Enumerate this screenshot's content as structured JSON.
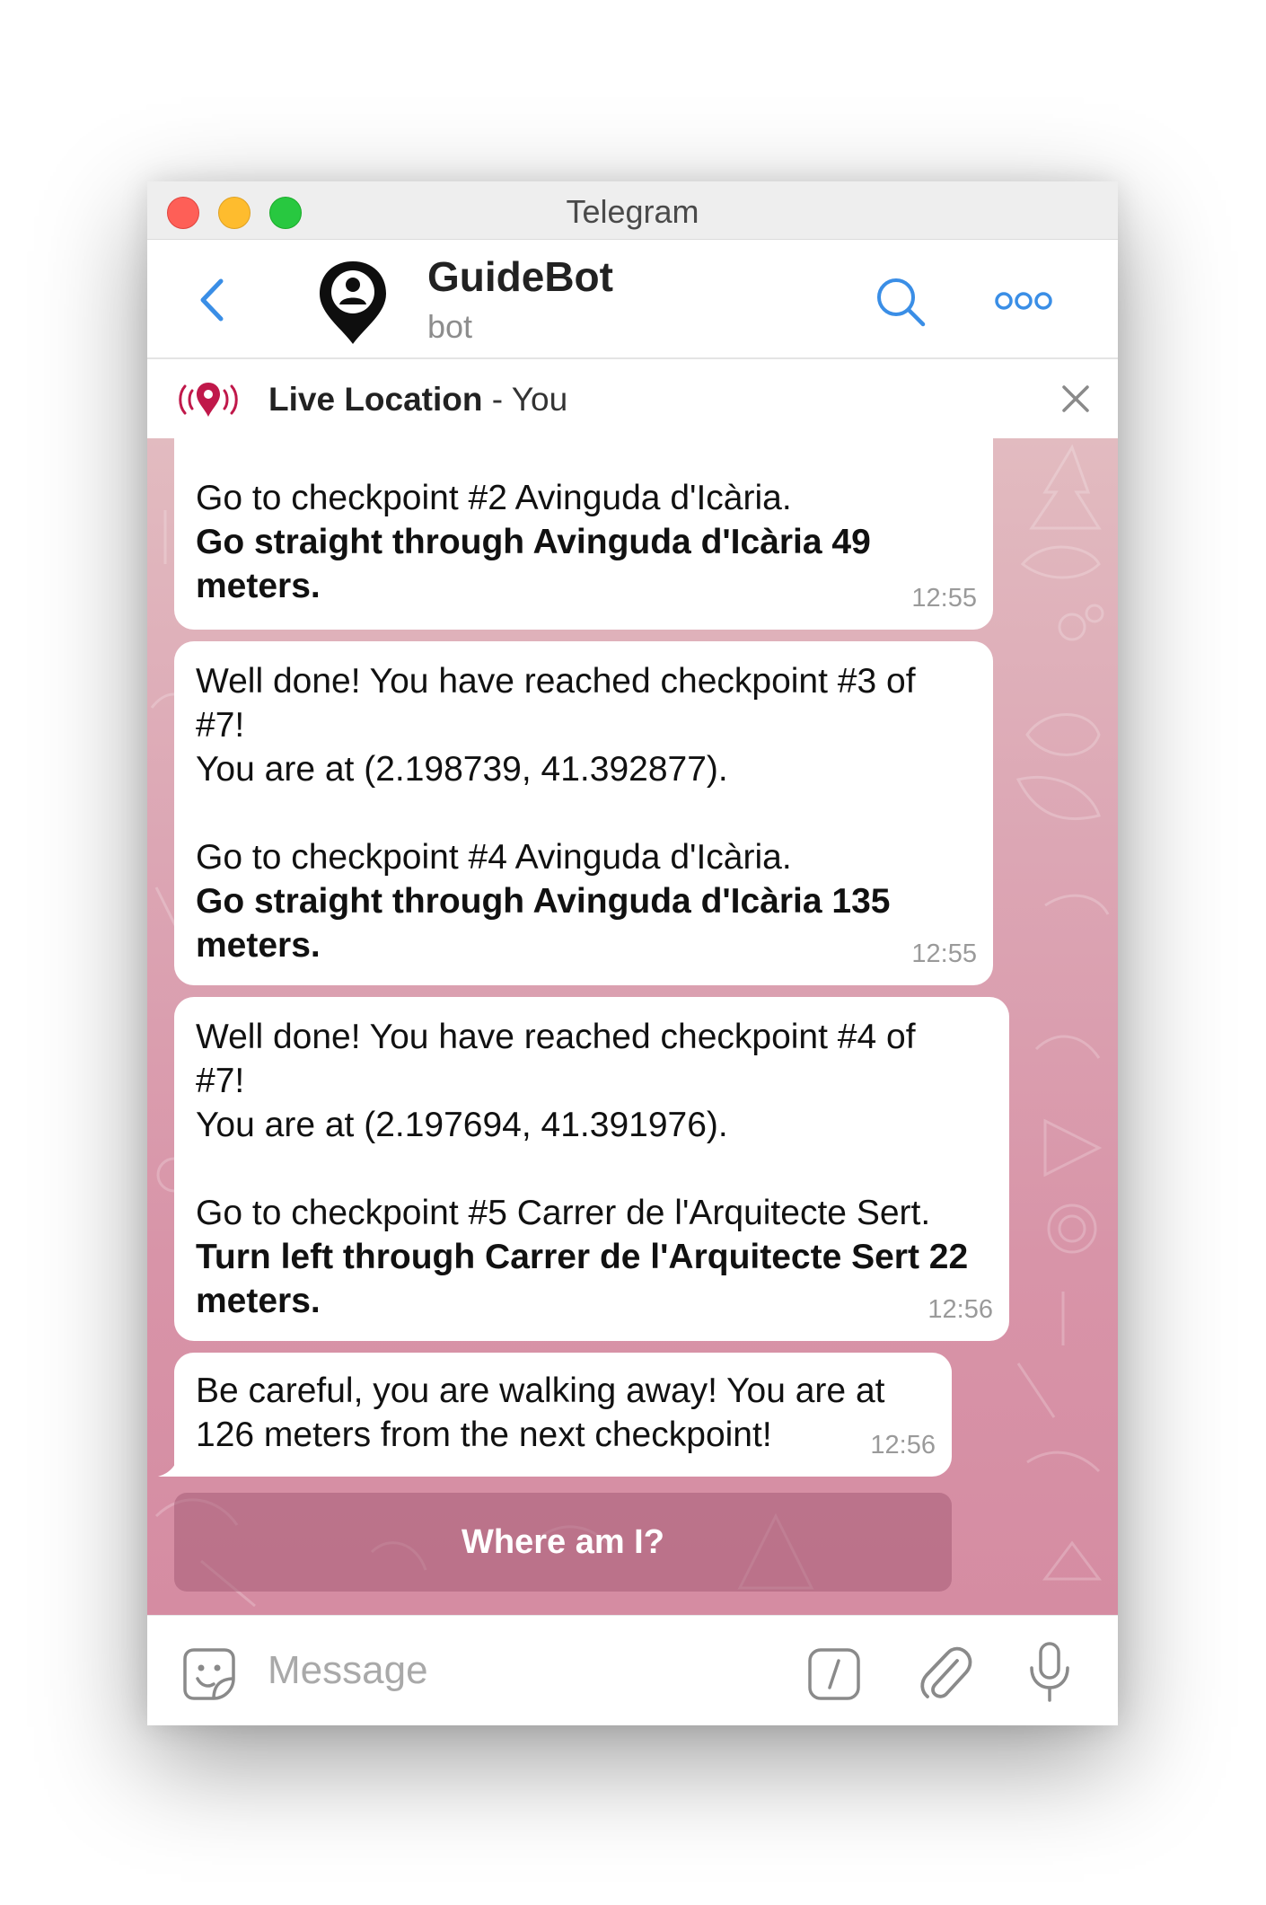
{
  "window": {
    "title": "Telegram"
  },
  "header": {
    "name": "GuideBot",
    "subtitle": "bot"
  },
  "live_location": {
    "label": "Live Location",
    "separator": " - ",
    "who": "You"
  },
  "messages": [
    {
      "lines": [
        "Go to checkpoint #2 Avinguda d'Icària."
      ],
      "bold_lines": [
        "Go straight through Avinguda d'Icària 49",
        "meters."
      ],
      "time": "12:55"
    },
    {
      "intro_lines": [
        "Well done! You have reached checkpoint #3 of",
        "#7!",
        "You are at (2.198739, 41.392877)."
      ],
      "lines": [
        "Go to checkpoint #4 Avinguda d'Icària."
      ],
      "bold_lines": [
        "Go straight through Avinguda d'Icària 135",
        "meters."
      ],
      "time": "12:55"
    },
    {
      "intro_lines": [
        "Well done! You have reached checkpoint #4 of",
        "#7!",
        "You are at (2.197694, 41.391976)."
      ],
      "lines": [
        "Go to checkpoint #5 Carrer de l'Arquitecte Sert."
      ],
      "bold_lines": [
        "Turn left through Carrer de l'Arquitecte Sert 22",
        "meters."
      ],
      "time": "12:56"
    },
    {
      "lines": [
        "Be careful, you are walking away! You are at",
        "126 meters from the next checkpoint!"
      ],
      "time": "12:56"
    }
  ],
  "keyboard": {
    "button_label": "Where am I?"
  },
  "composer": {
    "placeholder": "Message"
  },
  "colors": {
    "accent": "#3a8ee6",
    "live_pin": "#c0184a",
    "chat_bg_top": "#e2bbc0",
    "chat_bg_bottom": "#d58ca2"
  }
}
